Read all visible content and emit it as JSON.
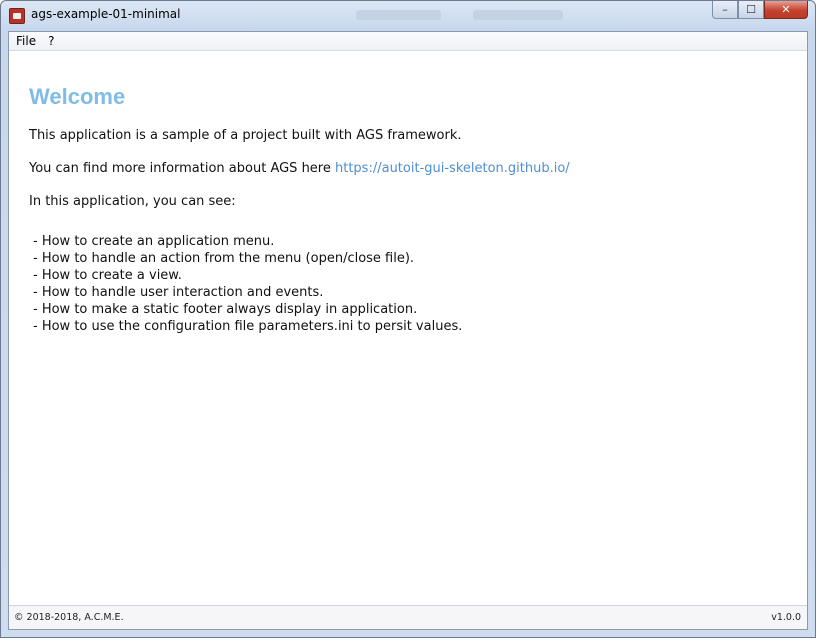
{
  "window": {
    "title": "ags-example-01-minimal",
    "controls": {
      "minimize": "–",
      "maximize": "☐",
      "close": "✕"
    }
  },
  "menu": {
    "items": [
      {
        "label": "File"
      },
      {
        "label": "?"
      }
    ]
  },
  "main": {
    "heading": "Welcome",
    "intro": "This application is a sample of a project built with AGS framework.",
    "info_prefix": "You can find more information about AGS here ",
    "info_link": "https://autoit-gui-skeleton.github.io/",
    "features_intro": "In this application, you can see:",
    "features": [
      "- How to create an application menu.",
      "- How to handle an action from the menu (open/close file).",
      "- How to create a view.",
      "- How to handle user interaction and events.",
      "- How to make a static footer always display in application.",
      "- How to use the configuration file parameters.ini to persit values."
    ]
  },
  "footer": {
    "copyright": "© 2018-2018, A.C.M.E.",
    "version": "v1.0.0"
  },
  "colors": {
    "heading": "#7fbde6",
    "link": "#4f8fd1",
    "close_button": "#c4432d"
  },
  "icons": {
    "app": "app-icon",
    "minimize": "minimize-icon",
    "maximize": "maximize-icon",
    "close": "close-icon"
  }
}
